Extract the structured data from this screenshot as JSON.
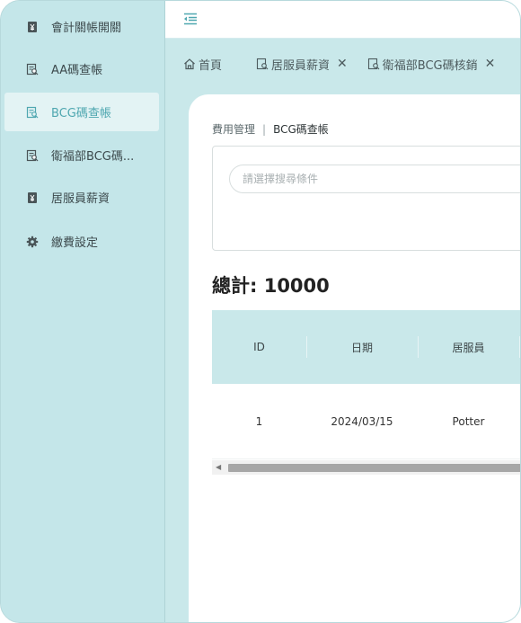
{
  "sidebar": {
    "items": [
      {
        "label": "會計關帳開關",
        "icon": "yen-box-icon",
        "active": false
      },
      {
        "label": "AA碼查帳",
        "icon": "doc-search-icon",
        "active": false
      },
      {
        "label": "BCG碼查帳",
        "icon": "doc-search-icon",
        "active": true
      },
      {
        "label": "衛福部BCG碼...",
        "icon": "doc-search-icon",
        "active": false
      },
      {
        "label": "居服員薪資",
        "icon": "yen-box-icon",
        "active": false
      },
      {
        "label": "繳費設定",
        "icon": "gear-icon",
        "active": false
      }
    ]
  },
  "tabs": [
    {
      "label": "首頁",
      "icon": "home-icon",
      "closable": false
    },
    {
      "label": "居服員薪資",
      "icon": "doc-search-icon",
      "closable": true
    },
    {
      "label": "衛福部BCG碼核銷",
      "icon": "doc-search-icon",
      "closable": true
    }
  ],
  "breadcrumb": {
    "parent": "費用管理",
    "separator": "|",
    "current": "BCG碼查帳"
  },
  "search": {
    "placeholder": "請選擇搜尋條件"
  },
  "total": {
    "text": "總計: 10000"
  },
  "table": {
    "headers": [
      "ID",
      "日期",
      "居服員"
    ],
    "rows": [
      [
        "1",
        "2024/03/15",
        "Potter"
      ]
    ]
  },
  "colors": {
    "accent": "#4fa7b0",
    "sidebar_bg": "#c4e6e9",
    "header_bg": "#c9e8ea"
  }
}
